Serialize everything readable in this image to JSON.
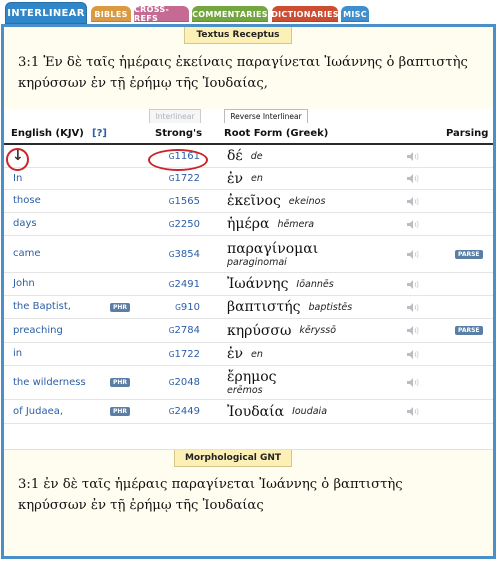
{
  "tabs": [
    {
      "label": "INTERLINEAR",
      "key": "interlinear"
    },
    {
      "label": "BIBLES",
      "key": "bibles"
    },
    {
      "label": "CROSS-REFS",
      "key": "crossrefs"
    },
    {
      "label": "COMMENTARIES",
      "key": "commentaries"
    },
    {
      "label": "DICTIONARIES",
      "key": "dictionaries"
    },
    {
      "label": "MISC",
      "key": "misc"
    }
  ],
  "top": {
    "banner": "Textus Receptus",
    "verse_line1": "3:1  Ἐν δὲ ταῖς ἡμέραις ἐκείναις παραγίνεται Ἰωάννης ὁ βαπτιστὴς",
    "verse_line2": "κηρύσσων ἐν τῇ ἐρήμῳ τῆς Ἰουδαίας,"
  },
  "table": {
    "interlinear_label": "Interlinear",
    "reverse_label": "Reverse Interlinear",
    "headers": {
      "english": "English (KJV)",
      "help": "[?]",
      "strongs": "Strong's",
      "root": "Root Form (Greek)",
      "parsing": "Parsing"
    },
    "rows": [
      {
        "english": "↓",
        "phr": "",
        "prefix": "G",
        "strongs": "1161",
        "greek": "δέ",
        "translit": "de",
        "parse": ""
      },
      {
        "english": "In",
        "phr": "",
        "prefix": "G",
        "strongs": "1722",
        "greek": "ἐν",
        "translit": "en",
        "parse": ""
      },
      {
        "english": "those",
        "phr": "",
        "prefix": "G",
        "strongs": "1565",
        "greek": "ἐκεῖνος",
        "translit": "ekeinos",
        "parse": ""
      },
      {
        "english": "days",
        "phr": "",
        "prefix": "G",
        "strongs": "2250",
        "greek": "ἡμέρα",
        "translit": "hēmera",
        "parse": ""
      },
      {
        "english": "came",
        "phr": "",
        "prefix": "G",
        "strongs": "3854",
        "greek": "παραγίνομαι",
        "translit": "paraginomai",
        "parse": "PARSE"
      },
      {
        "english": "John",
        "phr": "",
        "prefix": "G",
        "strongs": "2491",
        "greek": "Ἰωάννης",
        "translit": "Iōannēs",
        "parse": ""
      },
      {
        "english": "the Baptist,",
        "phr": "PHR",
        "prefix": "G",
        "strongs": "910",
        "greek": "βαπτιστής",
        "translit": "baptistēs",
        "parse": ""
      },
      {
        "english": "preaching",
        "phr": "",
        "prefix": "G",
        "strongs": "2784",
        "greek": "κηρύσσω",
        "translit": "kēryssō",
        "parse": "PARSE"
      },
      {
        "english": "in",
        "phr": "",
        "prefix": "G",
        "strongs": "1722",
        "greek": "ἐν",
        "translit": "en",
        "parse": ""
      },
      {
        "english": "the wilderness",
        "phr": "PHR",
        "prefix": "G",
        "strongs": "2048",
        "greek": "ἔρημος",
        "translit": "erēmos",
        "parse": ""
      },
      {
        "english": "of Judaea,",
        "phr": "PHR",
        "prefix": "G",
        "strongs": "2449",
        "greek": "Ἰουδαία",
        "translit": "Ioudaia",
        "parse": ""
      }
    ]
  },
  "bottom": {
    "banner": "Morphological GNT",
    "verse_line1": "3:1  ἐν δὲ ταῖς ἡμέραις παραγίνεται Ἰωάννης ὁ βαπτιστὴς",
    "verse_line2": "κηρύσσων ἐν τῇ ἐρήμῳ τῆς Ἰουδαίας"
  },
  "icons": {
    "speaker": "speaker-icon",
    "arrow": "down-arrow-icon"
  },
  "colors": {
    "active_tab": "#2f87c9",
    "link": "#2b5ea6",
    "highlight_oval": "#c8262b",
    "banner_bg": "#fdf0b6"
  }
}
